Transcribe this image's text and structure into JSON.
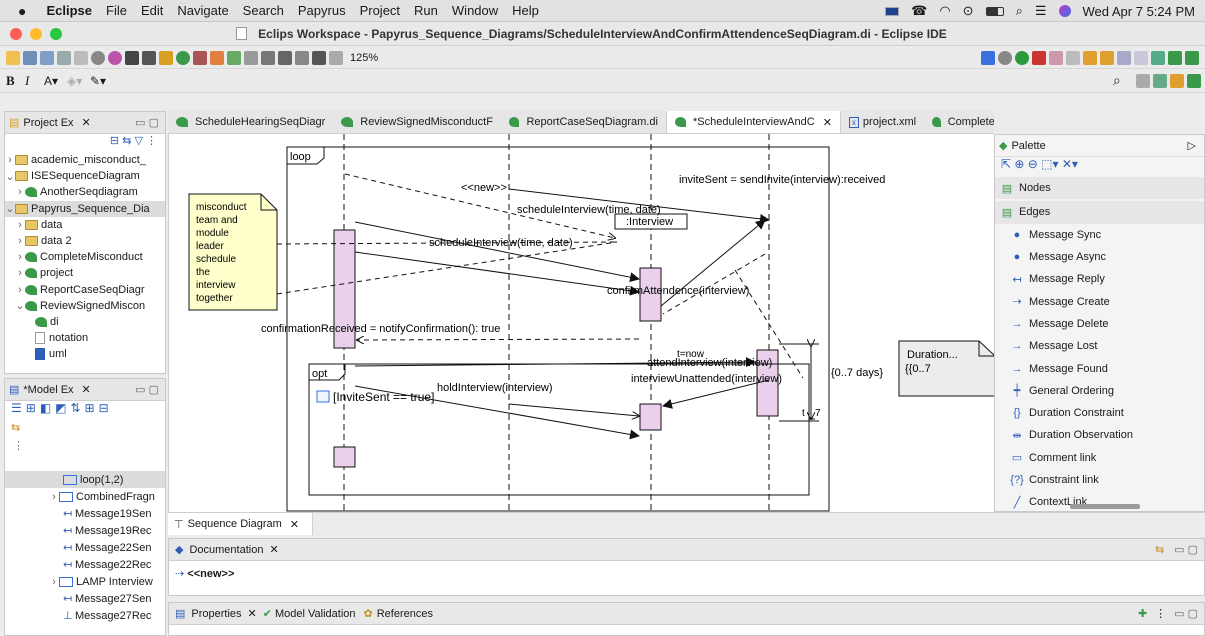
{
  "menubar": {
    "app": "Eclipse",
    "items": [
      "File",
      "Edit",
      "Navigate",
      "Search",
      "Papyrus",
      "Project",
      "Run",
      "Window",
      "Help"
    ],
    "clock": "Wed Apr 7  5:24 PM"
  },
  "window": {
    "title": "Eclips Workspace - Papyrus_Sequence_Diagrams/ScheduleInterviewAndConfirmAttendenceSeqDiagram.di - Eclipse IDE"
  },
  "toolbar": {
    "zoom": "125%"
  },
  "project_explorer": {
    "tab": "Project Ex",
    "items": [
      {
        "label": "academic_misconduct_"
      },
      {
        "label": "ISESequenceDiagram"
      },
      {
        "label": "AnotherSeqdiagram"
      },
      {
        "label": "Papyrus_Sequence_Dia"
      },
      {
        "label": "data"
      },
      {
        "label": "data 2"
      },
      {
        "label": "CompleteMisconduct"
      },
      {
        "label": "project"
      },
      {
        "label": "ReportCaseSeqDiagr"
      },
      {
        "label": "ReviewSignedMiscon"
      },
      {
        "label": "di"
      },
      {
        "label": "notation"
      },
      {
        "label": "uml"
      }
    ]
  },
  "model_explorer": {
    "tab": "*Model Ex",
    "items": [
      {
        "label": "loop(1,2)"
      },
      {
        "label": "CombinedFragn"
      },
      {
        "label": "Message19Sen"
      },
      {
        "label": "Message19Rec"
      },
      {
        "label": "Message22Sen"
      },
      {
        "label": "Message22Rec"
      },
      {
        "label": "LAMP Interview"
      },
      {
        "label": "Message27Sen"
      },
      {
        "label": "Message27Rec"
      }
    ]
  },
  "editor_tabs": [
    {
      "label": "ScheduleHearingSeqDiagr"
    },
    {
      "label": "ReviewSignedMisconductF"
    },
    {
      "label": "ReportCaseSeqDiagram.di"
    },
    {
      "label": "*ScheduleInterviewAndC"
    },
    {
      "label": "project.xml"
    },
    {
      "label": "CompleteMisconductForm"
    }
  ],
  "diagram": {
    "loop_label": "loop",
    "opt_label": "opt",
    "guard": "[InviteSent == true]",
    "note": [
      "misconduct",
      "team and",
      "module",
      "leader",
      "schedule",
      "the",
      "interview",
      "together"
    ],
    "interview_lifeline": ":Interview",
    "messages": {
      "new": "<<new>>",
      "invite": "inviteSent = sendInvite(interview):received",
      "schedule1": "scheduleInterview(time, date)",
      "schedule2": "scheduleInterview(time, date)",
      "confirm": "confirmAttendence(interview)",
      "confirmation": "confirmationReceived = notifyConfirmation(): true",
      "tnow": "t=now",
      "attend": "attendInterview(interview)",
      "hold": "holdInterview(interview)",
      "unattended": "interviewUnattended(interview)"
    },
    "duration_constraint": "{0..7 days}",
    "duration_t": "t",
    "duration_7": "7",
    "duration_note_title": "Duration...",
    "duration_note_body": "{{0..7"
  },
  "palette": {
    "title": "Palette",
    "nodes_label": "Nodes",
    "edges_label": "Edges",
    "items": [
      {
        "label": "Message Sync"
      },
      {
        "label": "Message Async"
      },
      {
        "label": "Message Reply"
      },
      {
        "label": "Message Create"
      },
      {
        "label": "Message Delete"
      },
      {
        "label": "Message Lost"
      },
      {
        "label": "Message Found"
      },
      {
        "label": "General Ordering"
      },
      {
        "label": "Duration Constraint"
      },
      {
        "label": "Duration Observation"
      },
      {
        "label": "Comment link"
      },
      {
        "label": "Constraint link"
      },
      {
        "label": "ContextLink"
      }
    ]
  },
  "bottom": {
    "sequence_tab": "Sequence Diagram",
    "documentation_tab": "Documentation",
    "doc_text": "<<new>>",
    "properties_tab": "Properties",
    "validation_tab": "Model Validation",
    "references_tab": "References"
  },
  "colors": {
    "accent": "#2d5fb8",
    "papyrus_green": "#3b9a4a",
    "note_fill": "#ffffcc",
    "activation_fill": "#e8c6e8"
  }
}
